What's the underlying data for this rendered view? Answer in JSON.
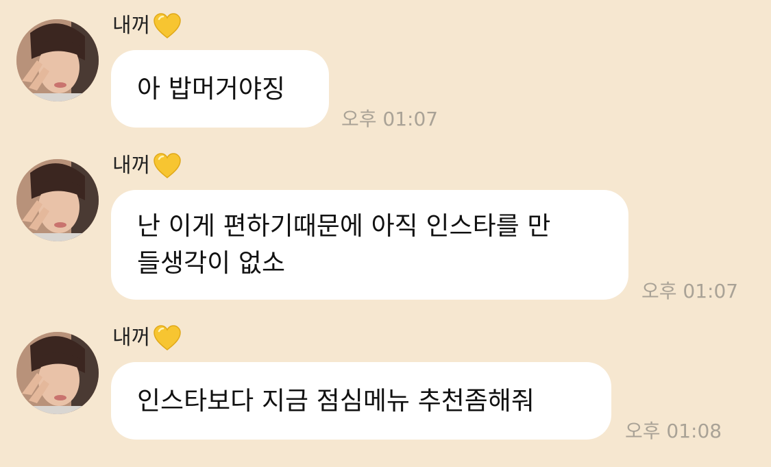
{
  "messages": [
    {
      "sender": "내꺼",
      "heart": "yellow-heart-icon",
      "text": "아 밥머거야징",
      "time": "오후 01:07"
    },
    {
      "sender": "내꺼",
      "heart": "yellow-heart-icon",
      "text": "난 이게 편하기때문에 아직 인스타를 만\n들생각이 없소",
      "time": "오후 01:07"
    },
    {
      "sender": "내꺼",
      "heart": "yellow-heart-icon",
      "text": "인스타보다 지금 점심메뉴 추천좀해줘",
      "time": "오후 01:08"
    }
  ],
  "colors": {
    "background": "#f6e7d0",
    "bubble": "#ffffff",
    "timestamp": "#a9a296",
    "heart": "#f7c531"
  }
}
